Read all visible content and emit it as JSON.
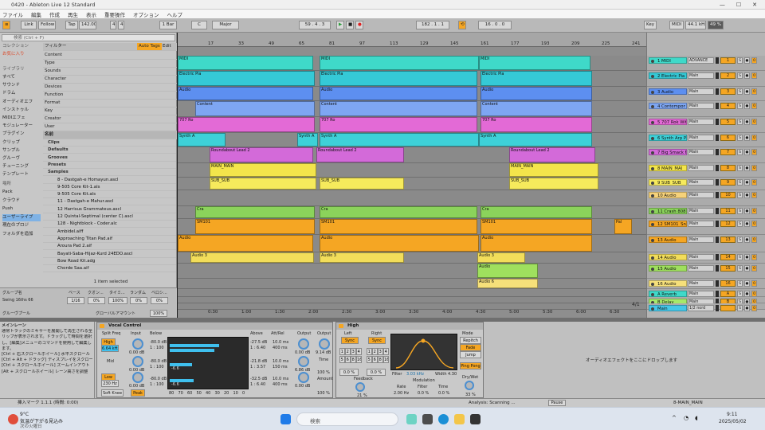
{
  "window": {
    "title": "0420 - Ableton Live 12 Standard",
    "min": "—",
    "max": "☐",
    "close": "✕"
  },
  "menu": [
    "ファイル",
    "編集",
    "作成",
    "再生",
    "表示",
    "重要操作",
    "オプション",
    "ヘルプ"
  ],
  "toolbar": {
    "link": "Link",
    "follow": "Follow",
    "tap": "Tap",
    "tempo": "142.00",
    "sig_num": "4",
    "sig_den": "4",
    "quant": "1 Bar",
    "key_root": "C",
    "key_scale": "Major",
    "position": "59 . 4 . 3",
    "loop_start": "182 . 1 . 1",
    "loop_len": "16 . 0 . 0",
    "key_btn": "Key",
    "midi_btn": "MIDI",
    "sample_rate": "44.1 kHz",
    "cpu": "49 %"
  },
  "browser": {
    "search_placeholder": "検索 (Ctrl + F)",
    "collections_header": "コレクション",
    "favorites": "お気に入り",
    "library_header": "ライブラリ",
    "library": [
      "すべて",
      "サウンド",
      "ドラム",
      "オーディオエフ",
      "インストゥル",
      "MIDIエフェ",
      "モジュレーター",
      "プラグイン",
      "クリップ",
      "サンプル",
      "グルーヴ",
      "チューニング",
      "テンプレート"
    ],
    "places_header": "場所",
    "places": [
      "Pack",
      "クラウド",
      "Push",
      "ユーザーライブ",
      "現在のプロジ",
      "フォルダを追加"
    ],
    "filter_label": "フィルター",
    "auto_tags": "Auto Tags",
    "edit": "Edit",
    "filters": [
      "Content",
      "Type",
      "Sounds",
      "Character",
      "Devices",
      "Function",
      "Format",
      "Key",
      "Creator",
      "User"
    ],
    "name_header": "名前",
    "files": [
      "Clips",
      "Defaults",
      "Grooves",
      "Presets",
      "Samples",
      "8 - Dastgah-e Homayun.ascl",
      "9-505 Core Kit-1.als",
      "9-505 Core Kit.als",
      "11 - Dastgah-e Mahur.ascl",
      "12 Harrisus Grammateus.ascl",
      "12 Quintal-Septimal (center C).ascl",
      "128 - Nightblock - Coder.alc",
      "Ambidel.aiff",
      "Approaching Titan Pad.aif",
      "Aroura Pad 2.aif",
      "Bayati-Saba-Hijaz-Kurd 24EDO.ascl",
      "Bow Road Kit.adg",
      "Chorde Saa.aif"
    ],
    "selected": "1 item selected"
  },
  "groove": {
    "title": "グルーヴプール",
    "name_header": "グループ名",
    "base": "ベース",
    "quant": "クオン...",
    "timing": "タイミ...",
    "random": "ランダム",
    "velocity": "ベロシ...",
    "item": "Swing 16ths 66",
    "base_val": "1/16",
    "q_val": "0%",
    "t_val": "100%",
    "r_val": "0%",
    "v_val": "0%",
    "pool_label": "グローバルアマウント",
    "pool_val": "100%"
  },
  "arrangement": {
    "bars": [
      "17",
      "33",
      "49",
      "65",
      "81",
      "97",
      "113",
      "129",
      "145",
      "161",
      "177",
      "193",
      "209",
      "225",
      "241"
    ],
    "times": [
      "0:30",
      "1:00",
      "1:30",
      "2:00",
      "2:30",
      "3:00",
      "3:30",
      "4:00",
      "4:30",
      "5:00",
      "5:30",
      "6:00",
      "6:30"
    ],
    "zoom": "4/1",
    "clip_labels": {
      "midi": "MIDI",
      "electric": "Electric Pia",
      "audio": "Audio",
      "content": "Content",
      "tr707": "707 Ro",
      "synth": "Synth A",
      "round": "Roundabout Lead 2",
      "main": "MAIN_MAIN",
      "sub": "SUB_SUB",
      "crash": "Cra",
      "sm": "SM101",
      "audio3": "Audio 3",
      "audio6": "Audio 6",
      "pal": "Pal"
    }
  },
  "tracks": [
    {
      "name": "1 MIDI",
      "route": "ADVANCE",
      "num": "1",
      "color": "#3fd9c9"
    },
    {
      "name": "2 Electric Pia",
      "route": "Main",
      "num": "2",
      "color": "#35c9d6"
    },
    {
      "name": "3 Audio",
      "route": "Main",
      "num": "3",
      "color": "#5d8ff0"
    },
    {
      "name": "4 Contempor",
      "route": "Main",
      "num": "4",
      "color": "#7ea6f2"
    },
    {
      "name": "5 707 Rok Wit",
      "route": "Main",
      "num": "5",
      "color": "#e36ad6"
    },
    {
      "name": "6 Synth Arp P",
      "route": "Main",
      "num": "6",
      "color": "#3ed1d8"
    },
    {
      "name": "7 Big Smack F",
      "route": "Main",
      "num": "7",
      "color": "#d36ad9"
    },
    {
      "name": "8 MAIN_MAI",
      "route": "Main",
      "num": "8",
      "color": "#f3e54b"
    },
    {
      "name": "9 SUB_SUB",
      "route": "Main",
      "num": "9",
      "color": "#f6ea5c"
    },
    {
      "name": "10 Audio",
      "route": "Main",
      "num": "10",
      "color": "#f6d27a"
    },
    {
      "name": "11 Crash 808",
      "route": "Main",
      "num": "11",
      "color": "#8bd35b"
    },
    {
      "name": "12 SM101_Sn",
      "route": "Main",
      "num": "12",
      "color": "#f5a623"
    },
    {
      "name": "13 Audio",
      "route": "Main",
      "num": "13",
      "color": "#f5a623"
    },
    {
      "name": "14 Audio",
      "route": "Main",
      "num": "14",
      "color": "#f2dd5a"
    },
    {
      "name": "15 Audio",
      "route": "Main",
      "num": "15",
      "color": "#9fe05e"
    },
    {
      "name": "16 Audio",
      "route": "Main",
      "num": "16",
      "color": "#f6e07a"
    },
    {
      "name": "A Reverb",
      "route": "Main",
      "num": "A",
      "color": "#3fd9c9"
    },
    {
      "name": "B Delay",
      "route": "Main",
      "num": "B",
      "color": "#a6e96a"
    },
    {
      "name": "Main",
      "route": "1/2 nord",
      "num": "",
      "color": "#45c7e8"
    }
  ],
  "info": {
    "title": "メインレーン",
    "lines": [
      "通常トラックのミキサーを展開して再生される全ク",
      "リップが表示されます。ドラッグして時間を選択",
      "し、[編集]メニューのコマンドを使用して編集し",
      "ます。",
      "",
      "[Ctrl + 右スクロールホイール] 水平スクロール",
      "[Ctrl + Alt + ドラッグ] ディスプレイをスクロール",
      "[Ctrl + スクロールホイール] ズームインアウト",
      "[Alt + スクロールホイール] レーン高さを調整"
    ]
  },
  "vocal_control": {
    "title": "Vocal Control",
    "split_freq": "Split Freq",
    "input": "Input",
    "below": "Below",
    "above": "Above",
    "att_rel": "Att/Rel",
    "output": "Output",
    "high": "High",
    "mid": "Mid",
    "low": "Low",
    "high_hz": "6.64 kHz",
    "low_hz": "230 Hz",
    "soft_knee": "Soft Knee",
    "peak": "Peak",
    "in_db1": "0.00 dB",
    "in_db2": "0.00 dB",
    "in_db3": "0.00 dB",
    "b1a": "-80.0 dB",
    "b1b": "1 : 100",
    "b2a": "-80.0 dB",
    "b2b": "1 : 100",
    "b3a": "-80.0 dB",
    "b3b": "1 : 100",
    "v1": "-6.6",
    "v2": "-6.6",
    "a1a": "-27.5 dB",
    "a1b": "1 : 6.40",
    "a2a": "-21.8 dB",
    "a2b": "1 : 3.57",
    "a3a": "-32.5 dB",
    "a3b": "1 : 6.40",
    "r1a": "10.0 ms",
    "r1b": "400 ms",
    "r2a": "10.0 ms",
    "r2b": "150 ms",
    "r3a": "10.0 ms",
    "r3b": "400 ms",
    "o1": "0.00 dB",
    "o2": "6.86 dB",
    "o3": "0.00 dB",
    "out_db": "9.14 dB",
    "time": "Time",
    "time_val": "100 %",
    "amount": "Amount",
    "amount_val": "100 %",
    "scale": [
      "80",
      "70",
      "60",
      "50",
      "40",
      "30",
      "20",
      "10",
      "0"
    ]
  },
  "echo": {
    "title": "High",
    "left": "Left",
    "right": "Right",
    "sync": "Sync",
    "l_vals": [
      "1",
      "2",
      "3",
      "4",
      "5",
      "6",
      "8",
      "16"
    ],
    "l_pct": "0.0 %",
    "r_pct": "0.0 %",
    "feedback": "Feedback",
    "fb_val": "21 %",
    "filter": "Filter",
    "filter_freq": "3.03 kHz",
    "width": "Width",
    "width_val": "4.30",
    "modulation": "Modulation",
    "rate": "Rate",
    "rate_val": "2.00 Hz",
    "filt": "Filter",
    "filt_val": "0.0 %",
    "time2": "Time",
    "time2_val": "0.0 %",
    "mode": "Mode",
    "repitch": "Repitch",
    "fade": "Fade",
    "jump": "Jump",
    "ping_pong": "Ping Pong",
    "dry_wet": "Dry/Wet",
    "dw_val": "33 %"
  },
  "drop_hint": "オーディオエフェクトをここにドロップします",
  "status": {
    "insert_marker": "挿入マーク 1.1.1 (時間: 0:00)",
    "analysis": "Analysis: Scanning ...",
    "pause": "Pause",
    "track": "8-MAIN_MAIN"
  },
  "taskbar": {
    "weather_temp": "9°C",
    "weather_text": "気温が下がる見込み",
    "weather_sub": "次の火曜日",
    "search": "検索",
    "time": "9:11",
    "date": "2025/05/02"
  }
}
